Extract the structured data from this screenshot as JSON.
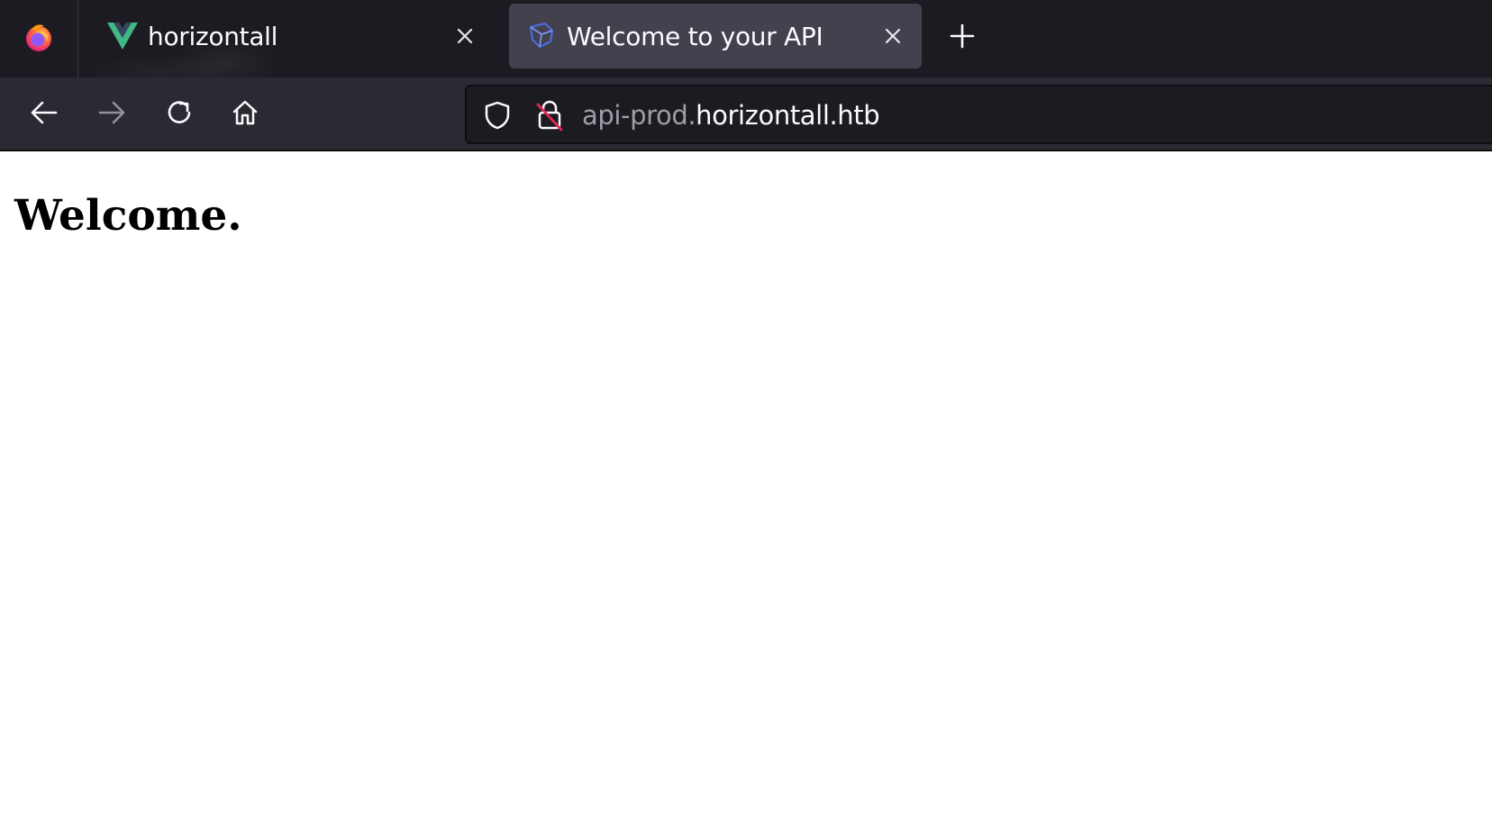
{
  "browser": {
    "tabs": [
      {
        "title": "horizontall",
        "icon": "vue-logo-icon",
        "active": false
      },
      {
        "title": "Welcome to your API",
        "icon": "strapi-logo-icon",
        "active": true
      }
    ],
    "url": {
      "subdomain": "api-prod.",
      "host": "horizontall.htb"
    }
  },
  "page": {
    "heading": "Welcome."
  },
  "colors": {
    "tabstrip": "#1c1b22",
    "active_tab": "#42414d",
    "navbar": "#2b2a33",
    "urlbar": "#1c1b22",
    "vue_green": "#41b883",
    "vue_dark": "#35495e",
    "firefox_orange": "#ff7139",
    "firefox_purple": "#9059ff",
    "lock_slash": "#e22850"
  }
}
